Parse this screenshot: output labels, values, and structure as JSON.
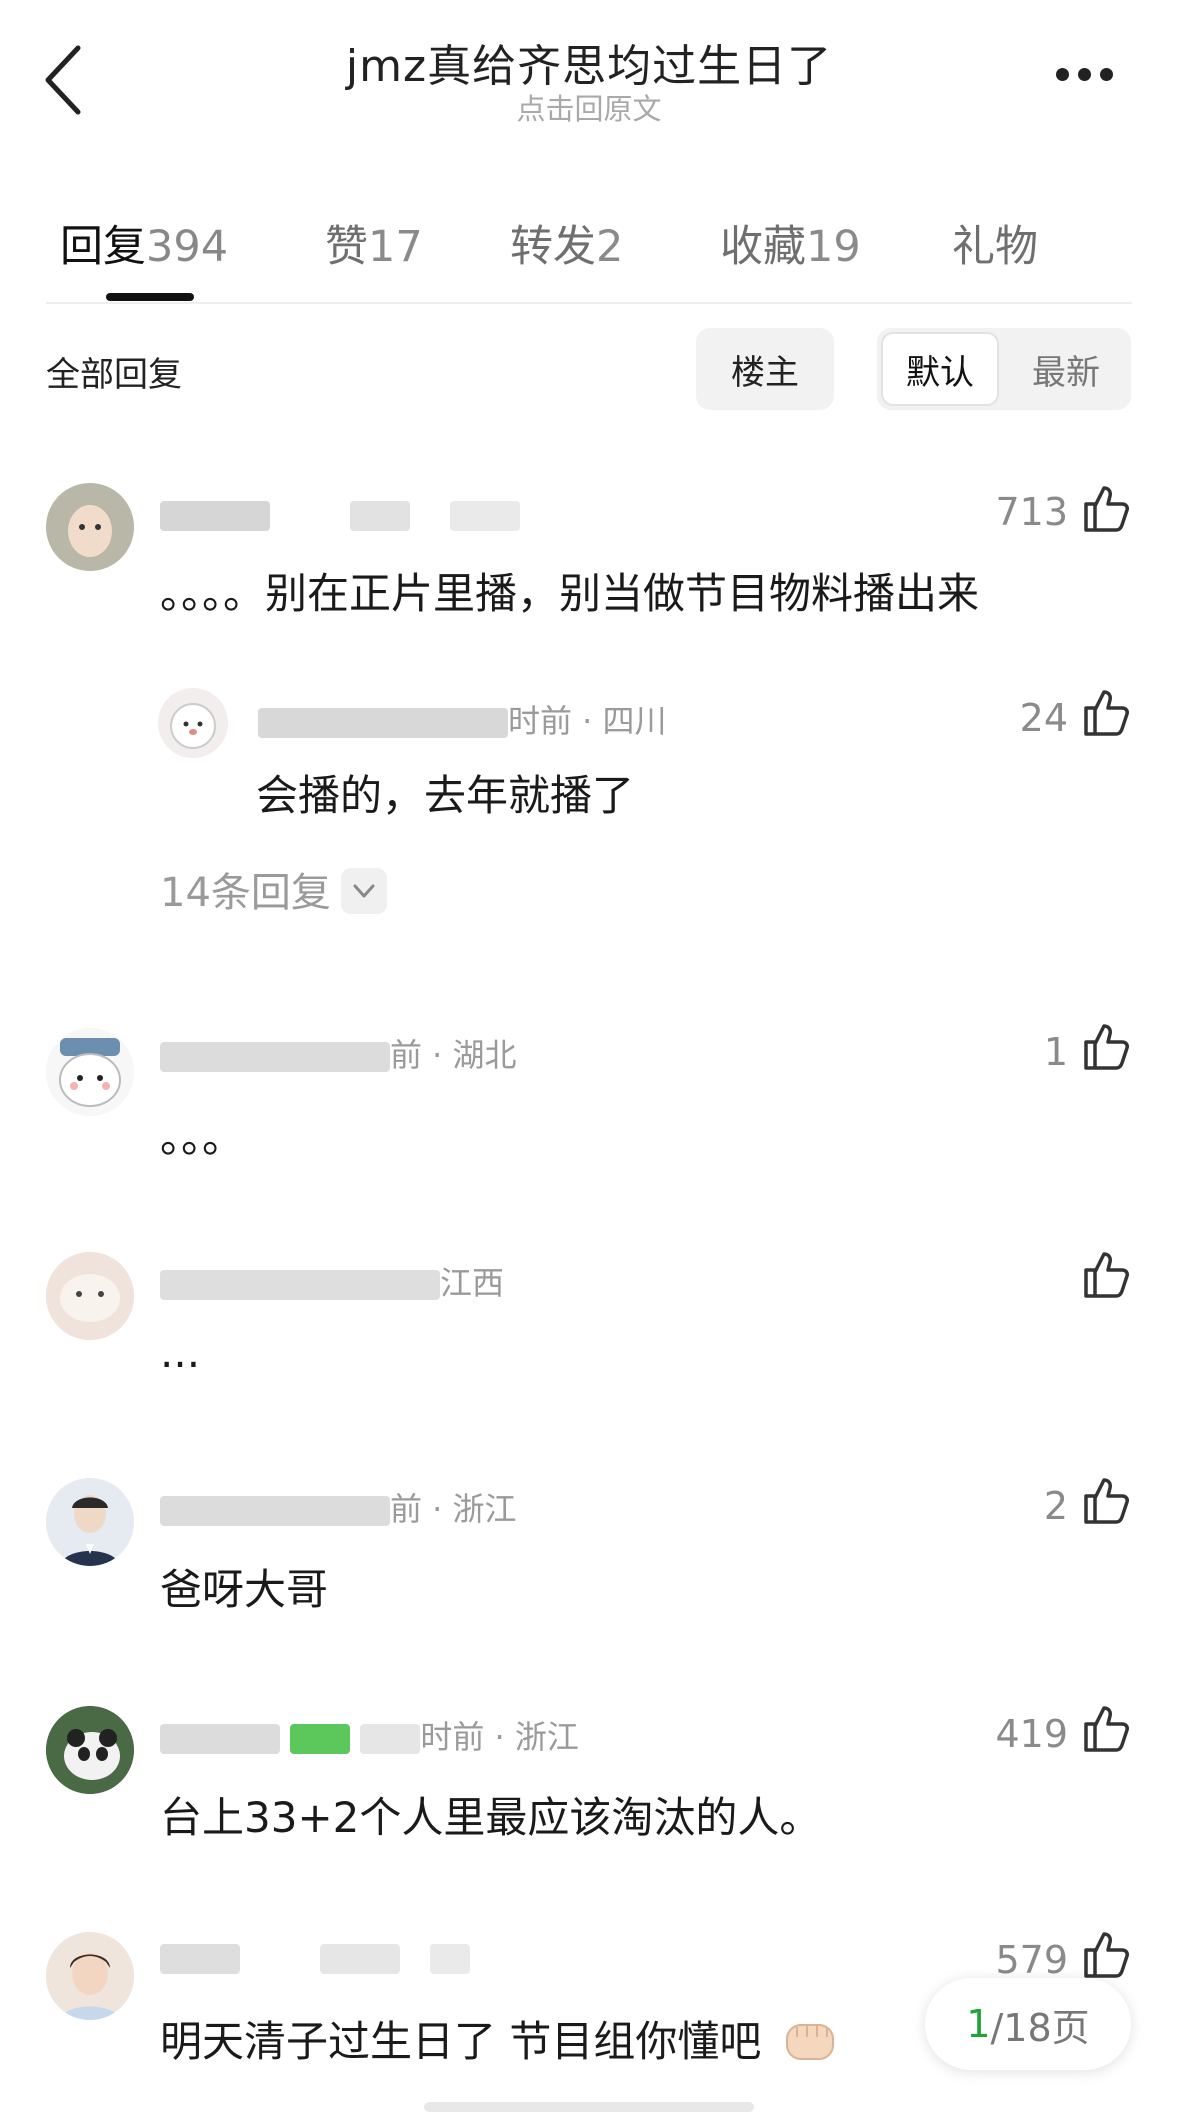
{
  "header": {
    "title": "jmz真给齐思均过生日了",
    "subtitle": "点击回原文"
  },
  "tabs": [
    {
      "label": "回复",
      "count": "394"
    },
    {
      "label": "赞",
      "count": "17"
    },
    {
      "label": "转发",
      "count": "2"
    },
    {
      "label": "收藏",
      "count": "19"
    },
    {
      "label": "礼物",
      "count": ""
    }
  ],
  "filter": {
    "all_replies": "全部回复",
    "owner": "楼主",
    "sort_default": "默认",
    "sort_latest": "最新"
  },
  "comments": [
    {
      "meta": "",
      "content": "。。。。别在正片里播，别当做节目物料播出来",
      "likes": "713",
      "reply": {
        "meta": "时前 · 四川",
        "content": "会播的，去年就播了",
        "likes": "24"
      },
      "expand_label": "14条回复"
    },
    {
      "meta": "前 · 湖北",
      "content": "。。。",
      "likes": "1"
    },
    {
      "meta": "江西",
      "content": "...",
      "likes": ""
    },
    {
      "meta": "前 · 浙江",
      "content": "爸呀大哥",
      "likes": "2"
    },
    {
      "meta": "时前 · 浙江",
      "content": "台上33+2个人里最应该淘汰的人。",
      "likes": "419"
    },
    {
      "meta": "",
      "content": "明天清子过生日了 节目组你懂吧",
      "likes": "579"
    }
  ],
  "pagination": {
    "current": "1",
    "total": "/18页"
  },
  "colors": {
    "accent_green": "#22a33a",
    "text_gray": "#9a9a9a"
  }
}
